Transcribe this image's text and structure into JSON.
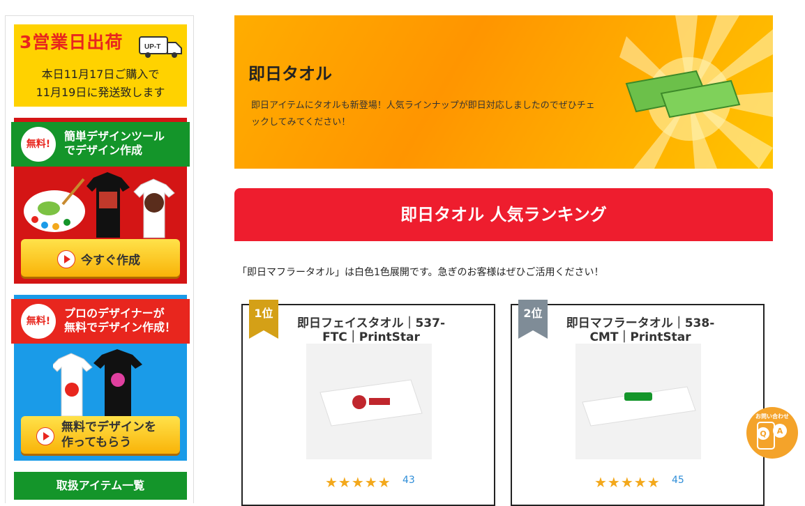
{
  "sidebar": {
    "shipping": {
      "title": "3営業日出荷",
      "truck_label": "UP-T",
      "line1": "本日11月17日ご購入で",
      "line2": "11月19日に発送致します"
    },
    "banner1": {
      "badge": "無料!",
      "text_line1": "簡単デザインツール",
      "text_line2": "でデザイン作成",
      "cta": "今すぐ作成"
    },
    "banner2": {
      "badge": "無料!",
      "text_line1": "プロのデザイナーが",
      "text_line2": "無料でデザイン作成！",
      "cta_line1": "無料でデザインを",
      "cta_line2": "作ってもらう"
    },
    "items_heading": "取扱アイテム一覧"
  },
  "hero": {
    "title": "即日タオル",
    "description": "即日アイテムにタオルも新登場！人気ラインナップが即日対応しましたのでぜひチェックしてみてください！"
  },
  "ranking": {
    "banner": "即日タオル 人気ランキング",
    "note": "「即日マフラータオル」は白色1色展開です。急ぎのお客様はぜひご活用ください！",
    "items": [
      {
        "rank": "1位",
        "title": "即日フェイスタオル｜537-FTC｜PrintStar",
        "stars": "★★★★★",
        "rating": 5,
        "reviews": "43",
        "badge_color": "#d4a017"
      },
      {
        "rank": "2位",
        "title": "即日マフラータオル｜538-CMT｜PrintStar",
        "stars": "★★★★★",
        "rating": 5,
        "reviews": "45",
        "badge_color": "#7f8c97"
      }
    ]
  },
  "help_button": {
    "label": "お問い合わせ",
    "icon": "qa-chat-icon"
  },
  "colors": {
    "accent_red": "#ee1d2e",
    "green": "#14952a",
    "blue": "#1a9be8",
    "yellow": "#ffd200",
    "star": "#f3a81b"
  }
}
